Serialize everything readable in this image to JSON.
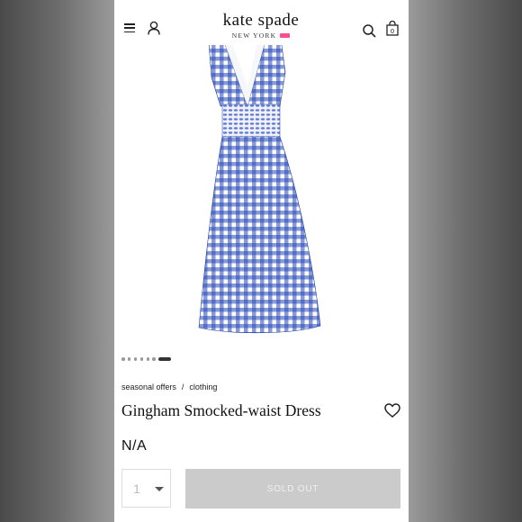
{
  "header": {
    "logo_main": "kate spade",
    "logo_sub": "NEW YORK",
    "cart_count": "0",
    "brand_pink": "#ff4e8f"
  },
  "icons": {
    "menu": "hamburger-menu-icon",
    "account": "user-icon",
    "search": "search-icon",
    "bag": "shopping-bag-icon",
    "wishlist": "heart-icon"
  },
  "product": {
    "image_pattern_color": "#2648b8",
    "carousel_total": 7,
    "carousel_active": 7,
    "breadcrumb": [
      "seasonal offers",
      "clothing"
    ],
    "breadcrumb_separator": "/",
    "title": "Gingham Smocked-waist Dress",
    "price": "N/A",
    "quantity": "1",
    "sold_out_label": "SOLD OUT"
  }
}
